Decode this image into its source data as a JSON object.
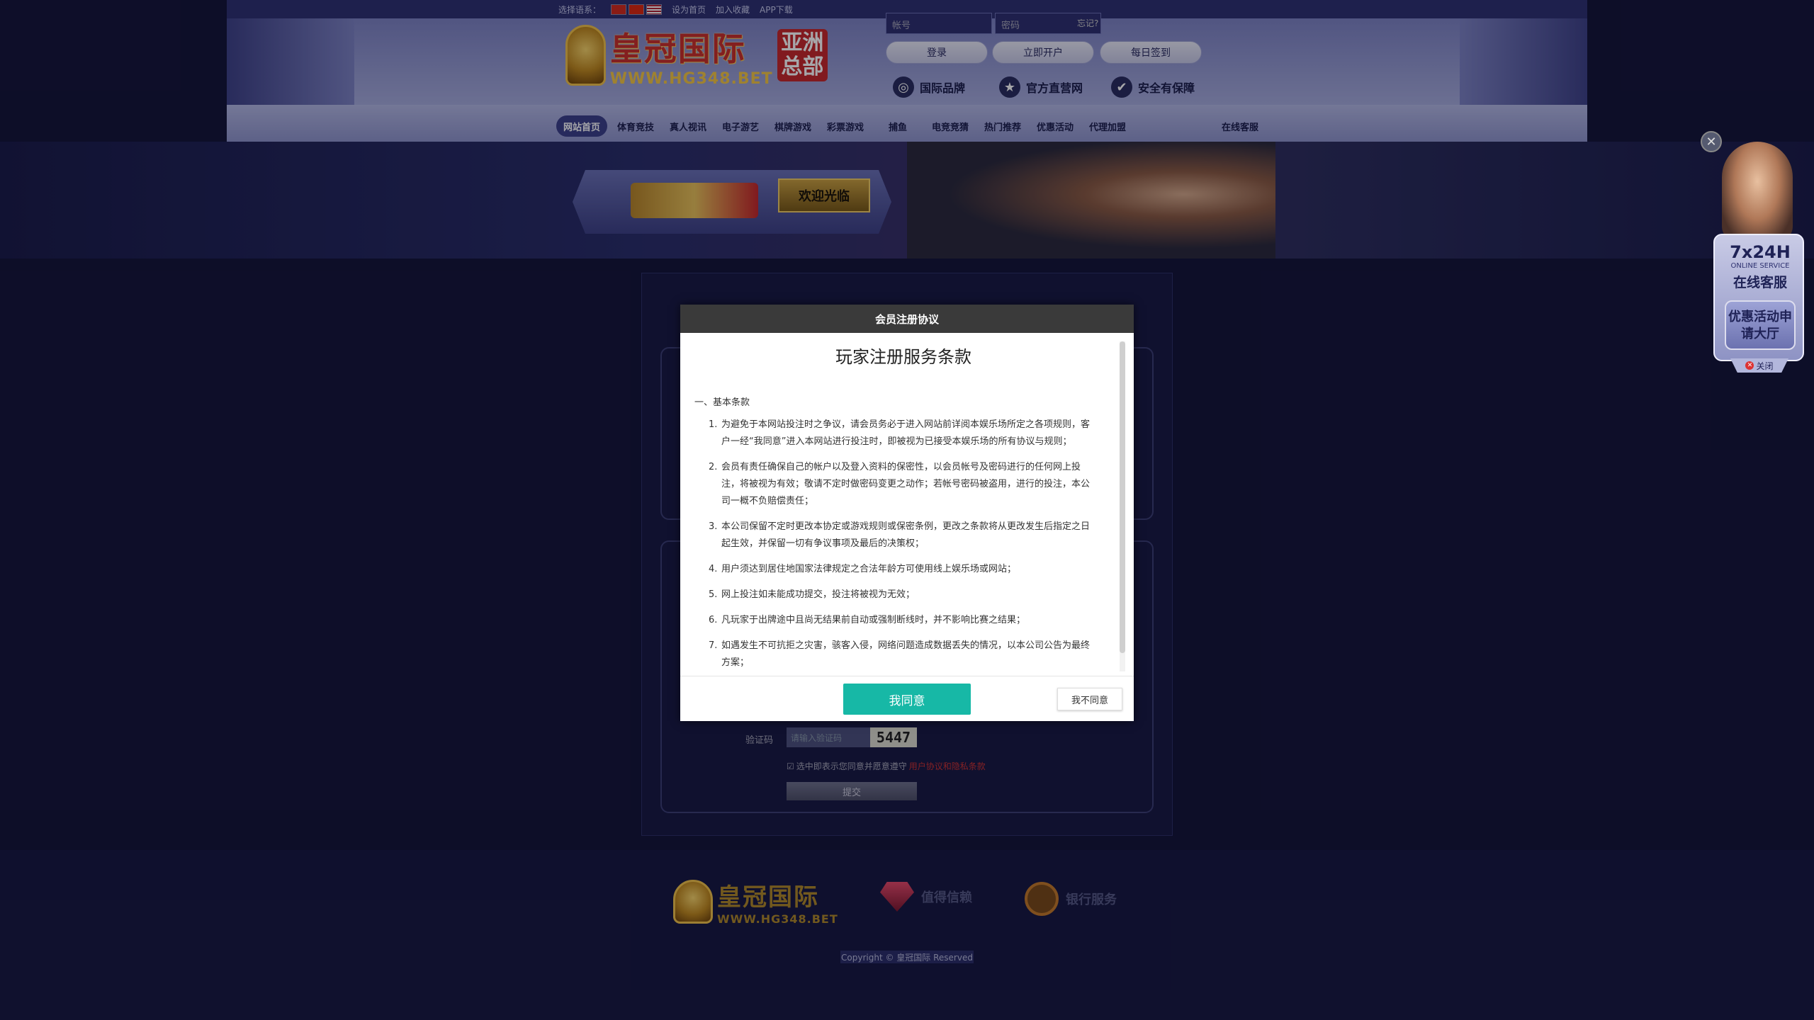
{
  "topbar": {
    "language_label": "选择语系：",
    "set_home": "设为首页",
    "bookmark": "加入收藏",
    "app_download": "APP下载"
  },
  "logo": {
    "name": "皇冠国际",
    "url": "WWW.HG348.BET",
    "badge": "亚洲总部"
  },
  "login": {
    "account_placeholder": "帐号",
    "password_placeholder": "密码",
    "forgot": "忘记?",
    "login_btn": "登录",
    "register_btn": "立即开户",
    "checkin_btn": "每日签到"
  },
  "features": [
    {
      "icon": "globe-icon",
      "label": "国际品牌"
    },
    {
      "icon": "star-icon",
      "label": "官方直营网"
    },
    {
      "icon": "check-icon",
      "label": "安全有保障"
    }
  ],
  "nav": {
    "items": [
      "网站首页",
      "体育竞技",
      "真人视讯",
      "电子游艺",
      "棋牌游戏",
      "彩票游戏",
      "捕鱼",
      "电竞竞猜",
      "热门推荐",
      "优惠活动",
      "代理加盟"
    ],
    "service": "在线客服"
  },
  "banner": {
    "welcome": "欢迎光临"
  },
  "form": {
    "captcha_label": "验证码",
    "captcha_placeholder": "请输入验证码",
    "captcha_code": "5447",
    "agree_text": "选中即表示您同意并愿意遵守",
    "agree_link": "用户协议和隐私条款",
    "submit": "提交"
  },
  "footer": {
    "feature1": "值得信赖",
    "feature2": "银行服务",
    "copyright": "Copyright © 皇冠国际 Reserved"
  },
  "modal": {
    "header": "会员注册协议",
    "title": "玩家注册服务条款",
    "section": "一、基本条款",
    "terms": [
      {
        "n": "1.",
        "text": "为避免于本网站投注时之争议，请会员务必于进入网站前详阅本娱乐场所定之各项规则，客户一经“我同意”进入本网站进行投注时，即被视为已接受本娱乐场的所有协议与规则；"
      },
      {
        "n": "2.",
        "text": "会员有责任确保自己的帐户以及登入资料的保密性，以会员帐号及密码进行的任何网上投注，将被视为有效；敬请不定时做密码变更之动作；若帐号密码被盗用，进行的投注，本公司一概不负赔偿责任；"
      },
      {
        "n": "3.",
        "text": "本公司保留不定时更改本协定或游戏规则或保密条例，更改之条款将从更改发生后指定之日起生效，并保留一切有争议事项及最后的决策权；"
      },
      {
        "n": "4.",
        "text": "用户须达到居住地国家法律规定之合法年龄方可使用线上娱乐场或网站；"
      },
      {
        "n": "5.",
        "text": "网上投注如未能成功提交，投注将被视为无效；"
      },
      {
        "n": "6.",
        "text": "凡玩家于出牌途中且尚无结果前自动或强制断线时，并不影响比赛之结果；"
      },
      {
        "n": "7.",
        "text": "如遇发生不可抗拒之灾害，骇客入侵，网络问题造成数据丢失的情况，以本公司公告为最终方案；"
      }
    ],
    "agree_btn": "我同意",
    "disagree_btn": "我不同意"
  },
  "float": {
    "hours": "7x24H",
    "online": "ONLINE SERVICE",
    "service": "在线客服",
    "promo": "优惠活动申请大厅",
    "close": "关闭"
  },
  "colors": {
    "teal": "#17b8a6",
    "header_gradient_top": "#4a4e92",
    "page_bg": "#15163a"
  }
}
